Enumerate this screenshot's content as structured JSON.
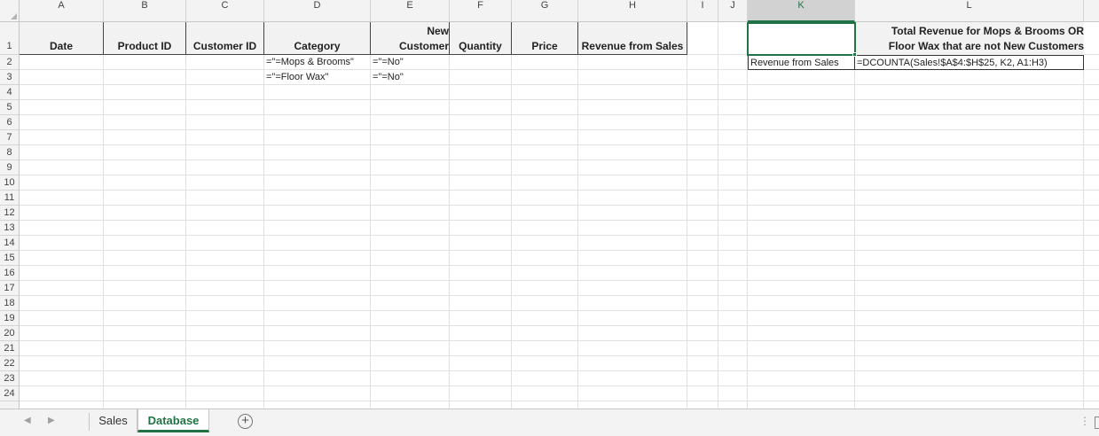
{
  "sheet": {
    "columns": [
      "A",
      "B",
      "C",
      "D",
      "E",
      "F",
      "G",
      "H",
      "I",
      "J",
      "K",
      "L"
    ],
    "active_column": "K",
    "rows": [
      "1",
      "2",
      "3",
      "4",
      "5",
      "6",
      "7",
      "8",
      "9",
      "10",
      "11",
      "12",
      "13",
      "14",
      "15",
      "16",
      "17",
      "18",
      "19",
      "20",
      "21",
      "22",
      "23",
      "24"
    ]
  },
  "table_headers": {
    "date": "Date",
    "product_id": "Product ID",
    "customer_id": "Customer ID",
    "category": "Category",
    "new_customer_line1": "New",
    "new_customer_line2": "Customer",
    "quantity": "Quantity",
    "price": "Price",
    "revenue": "Revenue from Sales"
  },
  "criteria": {
    "d2": "=\"=Mops & Brooms\"",
    "e2": "=\"=No\"",
    "d3": "=\"=Floor Wax\"",
    "e3": "=\"=No\""
  },
  "summary": {
    "title_line1": "Total Revenue for Mops & Brooms OR",
    "title_line2": "Floor Wax that are not New Customers",
    "k2": "Revenue from Sales",
    "l2": "=DCOUNTA(Sales!$A$4:$H$25, K2, A1:H3)"
  },
  "tabs": {
    "sales": "Sales",
    "database": "Database",
    "active": "Database"
  },
  "colors": {
    "accent": "#217346"
  }
}
